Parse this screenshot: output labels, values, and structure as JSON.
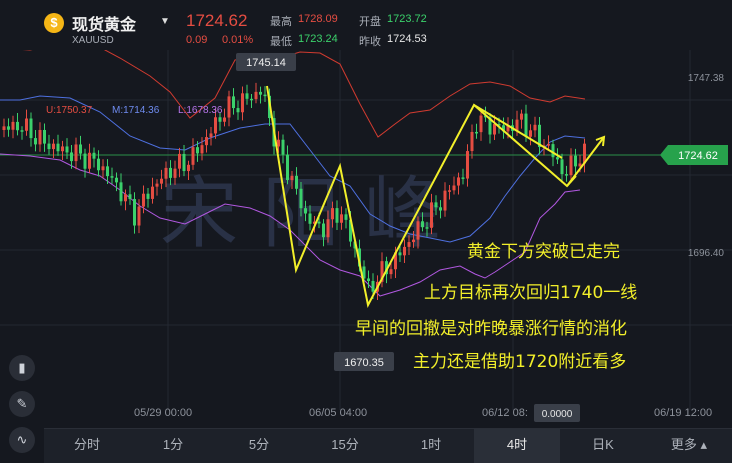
{
  "header": {
    "coin_symbol": "$",
    "title": "现货黄金",
    "symbol": "XAUUSD",
    "price": "1724.62",
    "change": "0.09",
    "change_pct": "0.01%",
    "high_label": "最高",
    "high": "1728.09",
    "open_label": "开盘",
    "open": "1723.72",
    "low_label": "最低",
    "low": "1723.24",
    "prev_close_label": "昨收",
    "prev_close": "1724.53"
  },
  "indicators": {
    "upper": "U:1750.37",
    "middle": "M:1714.36",
    "lower": "L:1678.36"
  },
  "price_axis": {
    "top": "1747.38",
    "current": "1724.62",
    "bottom": "1696.40"
  },
  "markers": {
    "high_tag": "1745.14",
    "low_tag": "1670.35",
    "time_tag": "0.0000"
  },
  "watermark": "宋阳峰",
  "annotations": [
    "黄金下方突破已走完",
    "上方目标再次回归1740一线",
    "早间的回撤是对昨晚暴涨行情的消化",
    "主力还是借助1720附近看多"
  ],
  "time_axis": [
    "05/29 00:00",
    "06/05 04:00",
    "06/12 08:",
    "06/19 12:00"
  ],
  "tools": [
    "candle-icon",
    "pen-icon",
    "indicator-icon"
  ],
  "tabs": [
    "分时",
    "1分",
    "5分",
    "15分",
    "1时",
    "4时",
    "日K",
    "更多 ▴"
  ],
  "active_tab": "4时",
  "colors": {
    "up": "#e54d42",
    "down": "#3bd16b",
    "accent_yellow": "#f2ef2a"
  }
}
